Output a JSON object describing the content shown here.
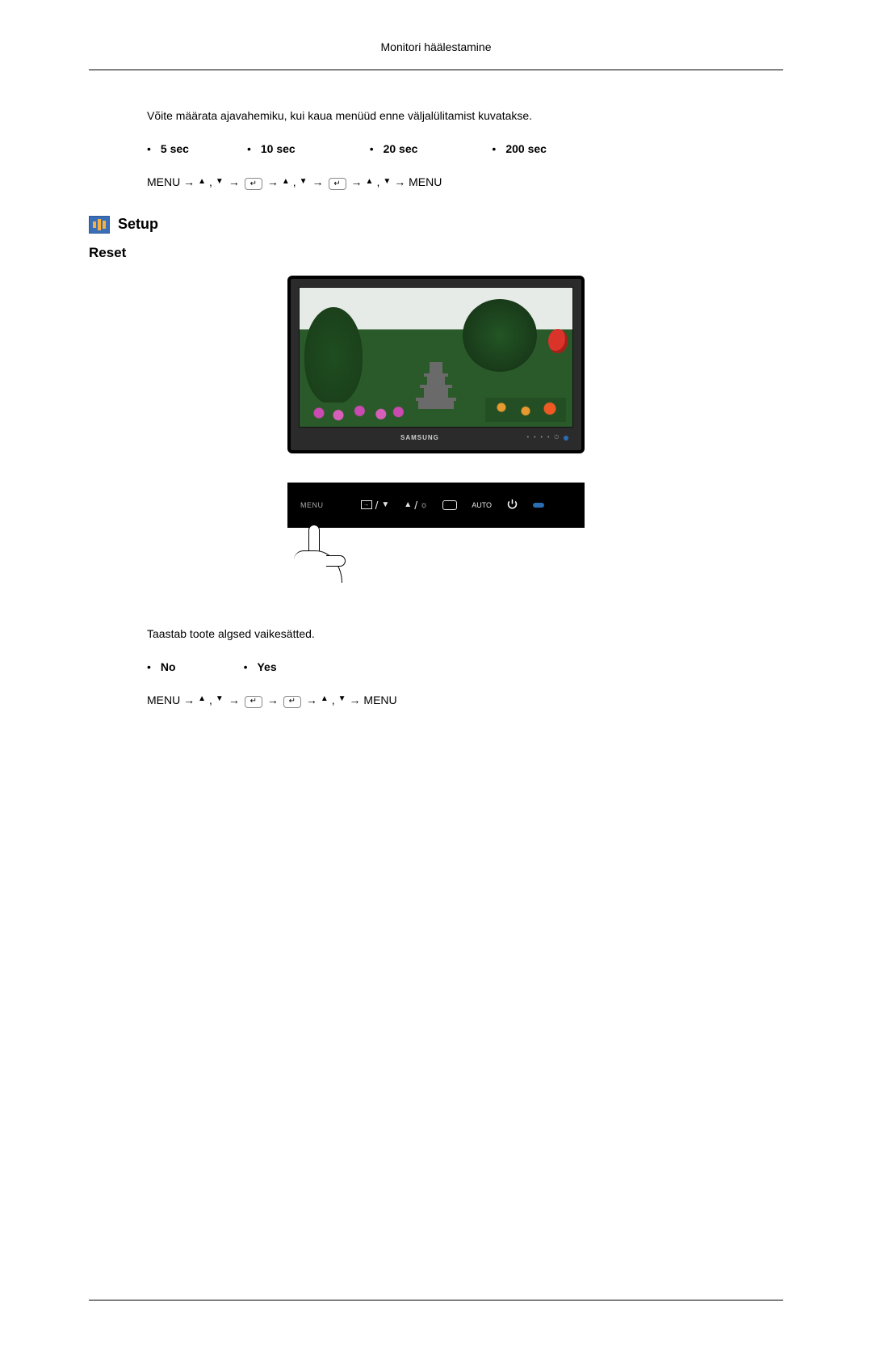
{
  "header": {
    "title": "Monitori häälestamine"
  },
  "intro": {
    "text": "Võite määrata ajavahemiku, kui kaua menüüd enne väljalülitamist kuvatakse."
  },
  "timeout_options": [
    "5 sec",
    "10 sec",
    "20 sec",
    "200 sec"
  ],
  "nav1": {
    "prefix": "MENU →",
    "suffix": "→ MENU"
  },
  "setup": {
    "label": "Setup"
  },
  "reset": {
    "heading": "Reset",
    "desc": "Taastab toote algsed vaikesätted.",
    "options": [
      "No",
      "Yes"
    ]
  },
  "nav2": {
    "prefix": "MENU →",
    "suffix": "→ MENU"
  },
  "monitor": {
    "brand": "SAMSUNG"
  },
  "touchbar": {
    "menu": "MENU",
    "auto": "AUTO"
  }
}
